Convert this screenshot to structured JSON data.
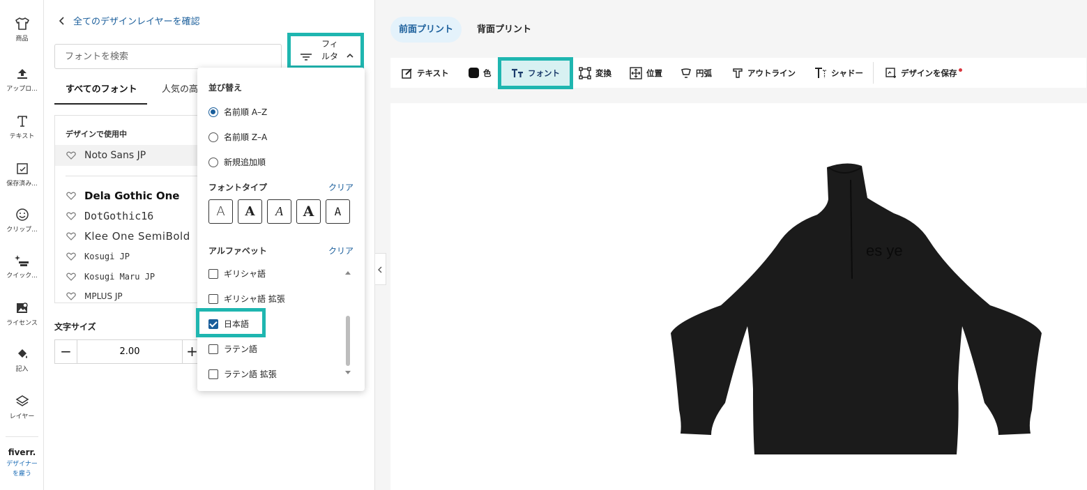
{
  "rail": [
    {
      "label": "商品",
      "icon": "shirt-icon"
    },
    {
      "label": "アップロ...",
      "icon": "upload-icon"
    },
    {
      "label": "テキスト",
      "icon": "text-icon"
    },
    {
      "label": "保存済み...",
      "icon": "saved-icon"
    },
    {
      "label": "クリップ...",
      "icon": "smiley-icon"
    },
    {
      "label": "クイック...",
      "icon": "magic-icon"
    },
    {
      "label": "ライセンス",
      "icon": "license-image-icon"
    },
    {
      "label": "記入",
      "icon": "paint-bucket-icon"
    },
    {
      "label": "レイヤー",
      "icon": "layers-icon"
    }
  ],
  "fiverr": {
    "logo": "fiverr.",
    "line1": "デザイナー",
    "line2": "を雇う"
  },
  "panel": {
    "back_label": "全てのデザインレイヤーを確認",
    "search_placeholder": "フォントを検索",
    "filter_label_1": "フィ",
    "filter_label_2": "ルタ",
    "tabs": [
      "すべてのフォント",
      "人気の高"
    ],
    "in_use_title": "デザインで使用中",
    "in_use_font": "Noto Sans JP",
    "fonts": [
      "Dela Gothic One",
      "DotGothic16",
      "Klee One SemiBold",
      "Kosugi JP",
      "Kosugi Maru JP",
      "MPLUS JP"
    ],
    "size_title": "文字サイズ",
    "size_value": "2.00",
    "minus": "−",
    "plus": "+"
  },
  "dropdown": {
    "sort_title": "並び替え",
    "sort_options": [
      "名前順 A–Z",
      "名前順 Z–A",
      "新規追加順"
    ],
    "font_type_title": "フォントタイプ",
    "clear": "クリア",
    "type_glyphs": [
      "A",
      "A",
      "A",
      "A",
      "A"
    ],
    "alphabet_title": "アルファベット",
    "alphabets": [
      {
        "label": "ギリシャ語",
        "checked": false
      },
      {
        "label": "ギリシャ語 拡張",
        "checked": false
      },
      {
        "label": "日本語",
        "checked": true
      },
      {
        "label": "ラテン語",
        "checked": false
      },
      {
        "label": "ラテン語 拡張",
        "checked": false
      }
    ]
  },
  "sides": [
    "前面プリント",
    "背面プリント"
  ],
  "toolbar": [
    "テキスト",
    "色",
    "フォント",
    "変換",
    "位置",
    "円弧",
    "アウトライン",
    "シャドー",
    "デザインを保存"
  ],
  "garment": {
    "print_text": "es ye",
    "color": "#1b1b1b"
  },
  "colors": {
    "accent": "#1fb6b0",
    "link": "#1a5e9b"
  }
}
